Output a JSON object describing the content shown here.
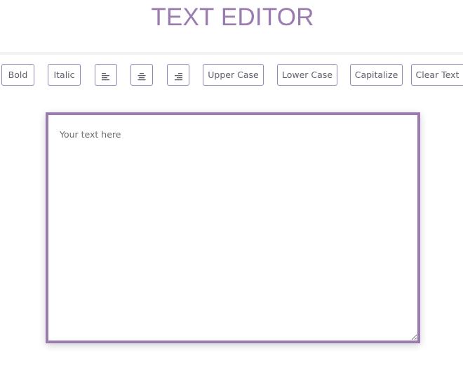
{
  "header": {
    "title": "TEXT EDITOR"
  },
  "toolbar": {
    "bold_label": "Bold",
    "italic_label": "Italic",
    "upper_label": "Upper Case",
    "lower_label": "Lower Case",
    "capitalize_label": "Capitalize",
    "clear_label": "Clear Text",
    "align_left_icon": "align-left-icon",
    "align_center_icon": "align-center-icon",
    "align_right_icon": "align-right-icon"
  },
  "editor": {
    "value": "",
    "placeholder": "Your text here"
  },
  "colors": {
    "accent": "#9a7bb0",
    "button_border": "#8f86bb",
    "button_text": "#5f5f6a",
    "divider": "#f2f2f4"
  }
}
